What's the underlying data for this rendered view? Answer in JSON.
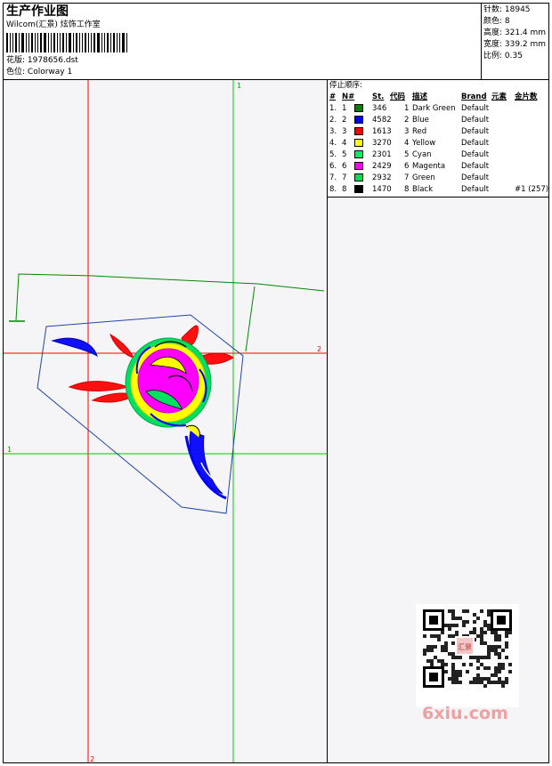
{
  "header": {
    "title": "生产作业图",
    "studio": "Wilcom(汇景) 炫饰工作室",
    "design_label": "花版:",
    "design_value": "1978656.dst",
    "colorway_label": "色位:",
    "colorway_value": "Colorway 1"
  },
  "stats": {
    "stitches": "针数: 18945",
    "colors": "颜色: 8",
    "height": "高度: 321.4 mm",
    "width": "宽度: 339.2 mm",
    "scale": "比例: 0.35"
  },
  "stop_sequence": {
    "title": "停止顺序:",
    "headers": [
      "#",
      "N#",
      "St.",
      "代码",
      "描述",
      "Brand",
      "元素",
      "金片数"
    ],
    "rows": [
      {
        "idx": "1.",
        "n": "1",
        "st": "346",
        "code": "1",
        "desc": "Dark Green",
        "brand": "Default",
        "extra": "",
        "color": "#008000"
      },
      {
        "idx": "2.",
        "n": "2",
        "st": "4582",
        "code": "2",
        "desc": "Blue",
        "brand": "Default",
        "extra": "",
        "color": "#0000ff"
      },
      {
        "idx": "3.",
        "n": "3",
        "st": "1613",
        "code": "3",
        "desc": "Red",
        "brand": "Default",
        "extra": "",
        "color": "#ff0000"
      },
      {
        "idx": "4.",
        "n": "4",
        "st": "3270",
        "code": "4",
        "desc": "Yellow",
        "brand": "Default",
        "extra": "",
        "color": "#ffff00"
      },
      {
        "idx": "5.",
        "n": "5",
        "st": "2301",
        "code": "5",
        "desc": "Cyan",
        "brand": "Default",
        "extra": "",
        "color": "#00ee66"
      },
      {
        "idx": "6.",
        "n": "6",
        "st": "2429",
        "code": "6",
        "desc": "Magenta",
        "brand": "Default",
        "extra": "",
        "color": "#ff00ff"
      },
      {
        "idx": "7.",
        "n": "7",
        "st": "2932",
        "code": "7",
        "desc": "Green",
        "brand": "Default",
        "extra": "",
        "color": "#00dd55"
      },
      {
        "idx": "8.",
        "n": "8",
        "st": "1470",
        "code": "8",
        "desc": "Black",
        "brand": "Default",
        "extra": "#1 (257)",
        "color": "#000000"
      }
    ]
  },
  "canvas": {
    "guide_labels": [
      "1",
      "2",
      "1",
      "2"
    ]
  },
  "watermark": {
    "text": "6xiu.com",
    "stamp": "汇景"
  }
}
